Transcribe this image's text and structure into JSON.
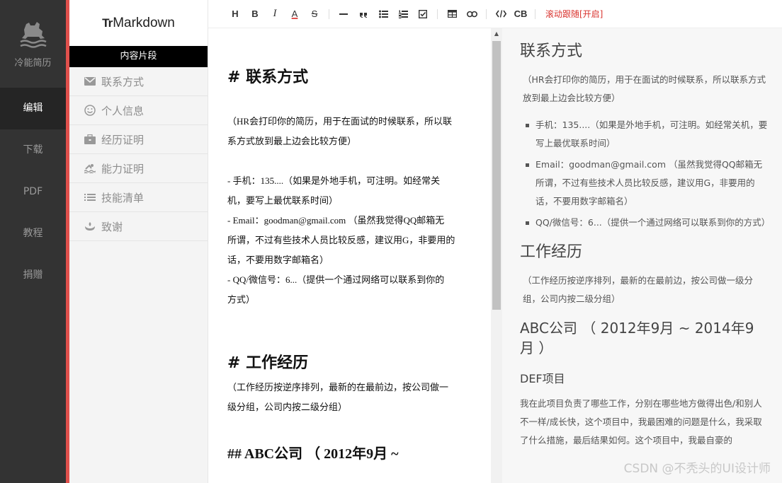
{
  "nav": {
    "brand": "冷能简历",
    "items": [
      "编辑",
      "下载",
      "PDF",
      "教程",
      "捐赠"
    ],
    "active_index": 0
  },
  "snippets": {
    "logo_prefix": "Tr",
    "logo_text": "Markdown",
    "header": "内容片段",
    "items": [
      {
        "label": "联系方式",
        "icon": "envelope-icon"
      },
      {
        "label": "个人信息",
        "icon": "smiley-icon"
      },
      {
        "label": "经历证明",
        "icon": "briefcase-icon"
      },
      {
        "label": "能力证明",
        "icon": "swimmer-icon"
      },
      {
        "label": "技能清单",
        "icon": "list-icon"
      },
      {
        "label": "致谢",
        "icon": "hands-icon"
      }
    ],
    "accent_color": "#e0504c"
  },
  "toolbar": {
    "h": "H",
    "b": "B",
    "i": "I",
    "a": "A",
    "s": "S",
    "cb": "CB",
    "sync": "滚动跟随[开启]"
  },
  "editor": {
    "h_contact": "# 联系方式",
    "p_contact_1": "（HR会打印你的简历，用于在面试的时候联系，所以联",
    "p_contact_2": "系方式放到最上边会比较方便）",
    "li_phone_1": "- 手机：135....（如果是外地手机，可注明。如经常关",
    "li_phone_2": "机，要写上最优联系时间）",
    "li_email_1": "- Email：goodman@gmail.com （虽然我觉得QQ邮箱无",
    "li_email_2": "所谓，不过有些技术人员比较反感，建议用G，非要用的",
    "li_email_3": "话，不要用数字邮箱名）",
    "li_qq_1": "- QQ/微信号：6...（提供一个通过网络可以联系到你的",
    "li_qq_2": "方式）",
    "h_work": "# 工作经历",
    "p_work_1": "（工作经历按逆序排列，最新的在最前边，按公司做一",
    "p_work_2": "级分组，公司内按二级分组）",
    "h_abc": "## ABC公司 （ 2012年9月 ~"
  },
  "preview": {
    "h_contact": "联系方式",
    "p_contact": "（HR会打印你的简历，用于在面试的时候联系，所以联系方式放到最上边会比较方便）",
    "li_phone": "手机：135....（如果是外地手机，可注明。如经常关机，要写上最优联系时间）",
    "li_email": "Email：goodman@gmail.com （虽然我觉得QQ邮箱无所谓，不过有些技术人员比较反感，建议用G，非要用的话，不要用数字邮箱名）",
    "li_qq": "QQ/微信号：6...（提供一个通过网络可以联系到你的方式）",
    "h_work": "工作经历",
    "p_work": "（工作经历按逆序排列，最新的在最前边，按公司做一级分组，公司内按二级分组）",
    "h_abc": "ABC公司 （ 2012年9月 ~ 2014年9月 ）",
    "h_def": "DEF项目",
    "p_def": "我在此项目负责了哪些工作，分别在哪些地方做得出色/和别人不一样/成长快，这个项目中，我最困难的问题是什么，我采取了什么措施，最后结果如何。这个项目中，我最自豪的"
  },
  "watermark": "CSDN @不秃头的UI设计师"
}
